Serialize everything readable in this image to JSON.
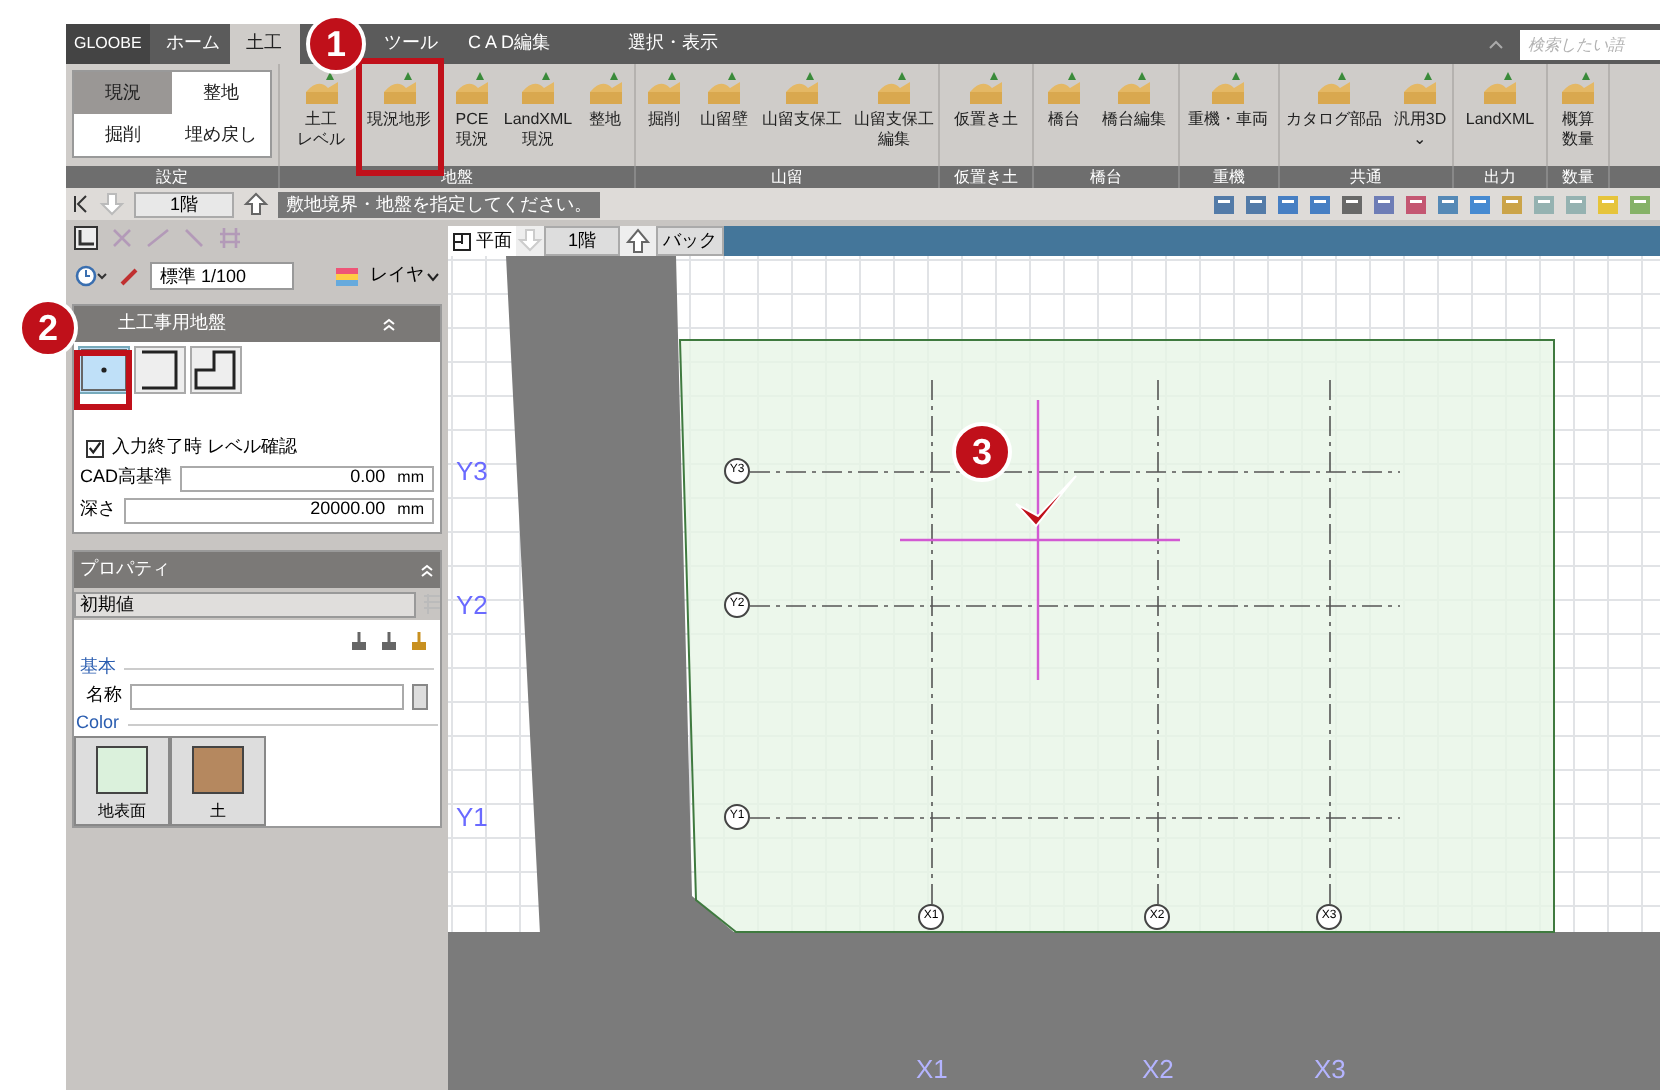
{
  "app_name": "GLOOBE",
  "tabs": [
    {
      "label": "ホーム",
      "selected": false
    },
    {
      "label": "土工",
      "selected": true
    },
    {
      "label": "ツール",
      "selected": false
    },
    {
      "label": "C A D編集",
      "selected": false
    },
    {
      "label": "選択・表示",
      "selected": false
    }
  ],
  "search": {
    "placeholder": "検索したい語"
  },
  "modes": [
    {
      "label": "現況",
      "selected": true
    },
    {
      "label": "整地",
      "selected": false
    },
    {
      "label": "掘削",
      "selected": false
    },
    {
      "label": "埋め戻し",
      "selected": false
    }
  ],
  "ribbon_groups": [
    {
      "label": "設定",
      "kind": "modes"
    },
    {
      "label": "地盤",
      "kind": "buttons",
      "buttons": [
        {
          "lines": [
            "土工",
            "レベル"
          ]
        },
        {
          "lines": [
            "現況地形"
          ]
        },
        {
          "lines": [
            "PCE",
            "現況"
          ]
        },
        {
          "lines": [
            "LandXML",
            "現況"
          ]
        },
        {
          "lines": [
            "整地"
          ]
        }
      ]
    },
    {
      "label": "山留",
      "kind": "buttons",
      "buttons": [
        {
          "lines": [
            "掘削"
          ]
        },
        {
          "lines": [
            "山留壁"
          ]
        },
        {
          "lines": [
            "山留支保工"
          ]
        },
        {
          "lines": [
            "山留支保工",
            "編集"
          ]
        }
      ]
    },
    {
      "label": "仮置き土",
      "kind": "buttons",
      "buttons": [
        {
          "lines": [
            "仮置き土"
          ]
        }
      ]
    },
    {
      "label": "橋台",
      "kind": "buttons",
      "buttons": [
        {
          "lines": [
            "橋台"
          ]
        },
        {
          "lines": [
            "橋台編集"
          ]
        }
      ]
    },
    {
      "label": "重機",
      "kind": "buttons",
      "buttons": [
        {
          "lines": [
            "重機・車両"
          ]
        }
      ]
    },
    {
      "label": "共通",
      "kind": "buttons",
      "buttons": [
        {
          "lines": [
            "カタログ部品"
          ]
        },
        {
          "lines": [
            "汎用3D",
            "⌄"
          ]
        }
      ]
    },
    {
      "label": "出力",
      "kind": "buttons",
      "buttons": [
        {
          "lines": [
            "LandXML"
          ]
        }
      ]
    },
    {
      "label": "数量",
      "kind": "buttons",
      "buttons": [
        {
          "lines": [
            "概算",
            "数量"
          ]
        }
      ]
    }
  ],
  "status": {
    "floor": "1階",
    "message": "敷地境界・地盤を指定してください。"
  },
  "panel": {
    "scale": "標準 1/100",
    "layer_button": "レイヤ",
    "section_title": "土工事用地盤",
    "shapes": [
      {
        "selected": true
      },
      {
        "selected": false
      },
      {
        "selected": false
      }
    ],
    "level_check": {
      "label": "入力終了時 レベル確認",
      "checked": true
    },
    "fields": [
      {
        "label": "CAD高基準",
        "value": "0.00",
        "unit": "mm"
      },
      {
        "label": "深さ",
        "value": "20000.00",
        "unit": "mm"
      }
    ]
  },
  "properties": {
    "title": "プロパティ",
    "preset": "初期値",
    "section": "基本",
    "name_label": "名称",
    "color_section": "Color",
    "swatches": [
      {
        "label": "地表面",
        "color": "#dbf1dc"
      },
      {
        "label": "土",
        "color": "#b5885f"
      }
    ]
  },
  "view_tabs": {
    "view": "平面",
    "floor": "1階",
    "back": "バック"
  },
  "axes": {
    "rows": [
      {
        "label": "Y3",
        "bubble": "Y3"
      },
      {
        "label": "Y2",
        "bubble": "Y2"
      },
      {
        "label": "Y1",
        "bubble": "Y1"
      }
    ],
    "columns": [
      {
        "label": "X1",
        "bubble": "X1"
      },
      {
        "label": "X2",
        "bubble": "X2"
      },
      {
        "label": "X3",
        "bubble": "X3"
      }
    ]
  },
  "callouts": [
    "1",
    "2",
    "3"
  ]
}
